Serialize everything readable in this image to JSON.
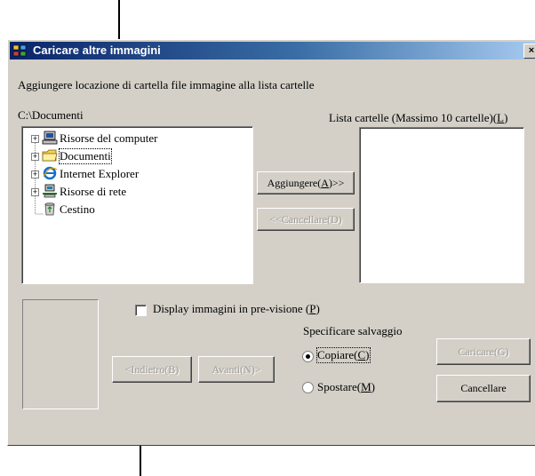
{
  "window": {
    "title": "Caricare altre immagini",
    "close_label": "×"
  },
  "instruction": "Aggiungere locazione di cartella file immagine alla lista cartelle",
  "current_path": "C:\\Documenti",
  "folder_list_label": "Lista cartelle (Massimo 10 cartelle)(L)",
  "tree": [
    {
      "label": "Risorse del computer",
      "icon": "computer-icon",
      "expandable": true
    },
    {
      "label": "Documenti",
      "icon": "folder-icon",
      "expandable": true,
      "selected": true
    },
    {
      "label": "Internet Explorer",
      "icon": "internet-explorer-icon",
      "expandable": true
    },
    {
      "label": "Risorse di rete",
      "icon": "network-icon",
      "expandable": true
    },
    {
      "label": "Cestino",
      "icon": "recycle-bin-icon",
      "expandable": false
    }
  ],
  "buttons": {
    "add": "Aggiungere(A)>>",
    "remove": "<<Cancellare(D)",
    "back": "<Indietro(B)",
    "forward": "Avanti(N)>",
    "load": "Caricare(G)",
    "cancel": "Cancellare"
  },
  "preview_checkbox": {
    "label": "Display immagini in pre-visione (P)",
    "checked": false
  },
  "save_group": {
    "label": "Specificare salvaggio",
    "options": [
      {
        "label": "Copiare(C)",
        "selected": true
      },
      {
        "label": "Spostare(M)",
        "selected": false
      }
    ]
  }
}
